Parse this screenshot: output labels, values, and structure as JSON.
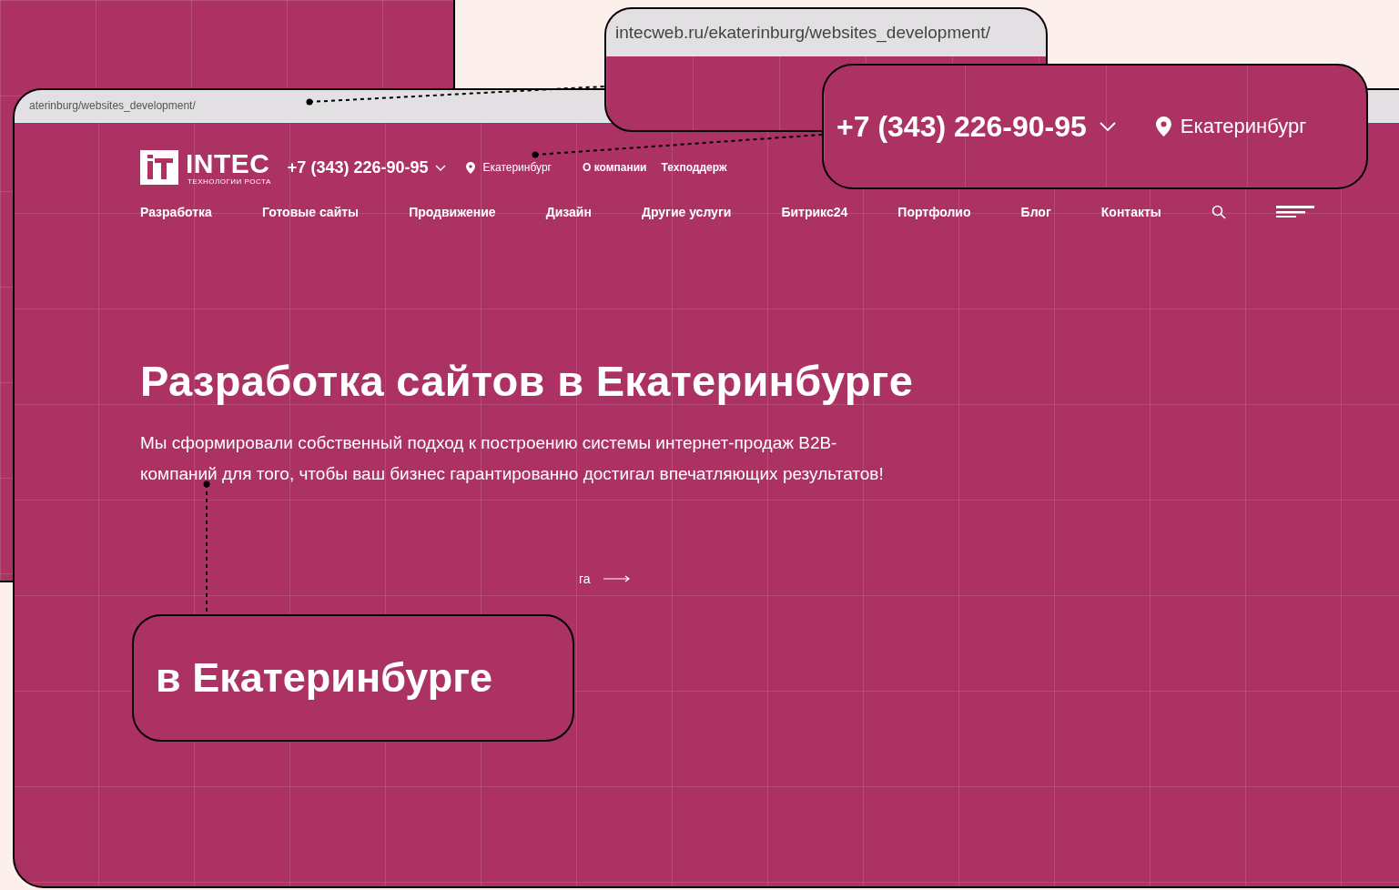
{
  "browser": {
    "url": "aterinburg/websites_development/"
  },
  "header": {
    "logo": {
      "name": "INTEC",
      "tagline": "ТЕХНОЛОГИИ РОСТА"
    },
    "phone": "+7 (343) 226-90-95",
    "city": "Екатеринбург",
    "links": [
      "О компании",
      "Техподдерж"
    ]
  },
  "nav": {
    "items": [
      "Разработка",
      "Готовые сайты",
      "Продвижение",
      "Дизайн",
      "Другие услуги",
      "Битрикс24",
      "Портфолио",
      "Блог",
      "Контакты"
    ]
  },
  "hero": {
    "title": "Разработка сайтов в Екатеринбурге",
    "text": "Мы сформировали собственный подход к построению системы интернет-продаж B2B-компаний для того, чтобы ваш бизнес гарантированно достигал впечатляющих результатов!",
    "button_fragment": "га"
  },
  "callouts": {
    "url": "intecweb.ru/ekaterinburg/websites_development/",
    "phone": "+7 (343) 226-90-95",
    "city": "Екатеринбург",
    "title_fragment": "в Екатеринбурге"
  }
}
